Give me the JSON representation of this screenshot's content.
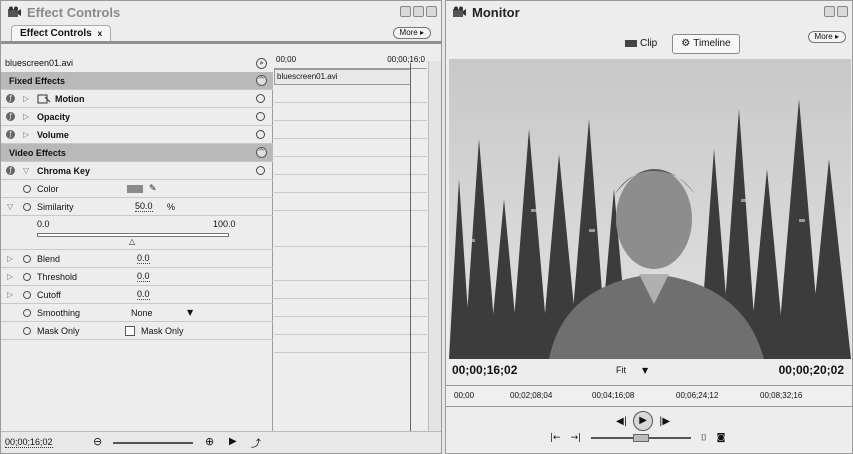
{
  "effect_controls": {
    "window_title": "Effect Controls",
    "tab_label": "Effect Controls",
    "tab_close": "x",
    "more_label": "More ▸",
    "clip_name": "bluescreen01.avi",
    "timeline_clip_label": "bluescreen01.avi",
    "ruler_start": "00;00",
    "ruler_end": "00;00;16;0",
    "sections": {
      "fixed": "Fixed Effects",
      "video": "Video Effects"
    },
    "effects": {
      "motion": "Motion",
      "opacity": "Opacity",
      "volume": "Volume",
      "chroma_key": "Chroma Key"
    },
    "params": {
      "color": "Color",
      "similarity": "Similarity",
      "similarity_value": "50.0",
      "similarity_unit": "%",
      "slider_min": "0.0",
      "slider_max": "100.0",
      "similarity_fraction": 0.5,
      "blend": "Blend",
      "blend_value": "0.0",
      "threshold": "Threshold",
      "threshold_value": "0.0",
      "cutoff": "Cutoff",
      "cutoff_value": "0.0",
      "smoothing": "Smoothing",
      "smoothing_value": "None",
      "mask_only": "Mask Only",
      "mask_only_checkbox": "Mask Only"
    },
    "timecode": "00;00;16;02",
    "color_swatch": "#8a8a8a"
  },
  "monitor": {
    "window_title": "Monitor",
    "more_label": "More ▸",
    "tabs": {
      "clip": "Clip",
      "timeline": "Timeline"
    },
    "timecode_current": "00;00;16;02",
    "timecode_duration": "00;00;20;02",
    "fit": "Fit",
    "ruler_ticks": [
      "00;00",
      "00;02;08;04",
      "00;04;16;08",
      "00;06;24;12",
      "00;08;32;16"
    ]
  }
}
